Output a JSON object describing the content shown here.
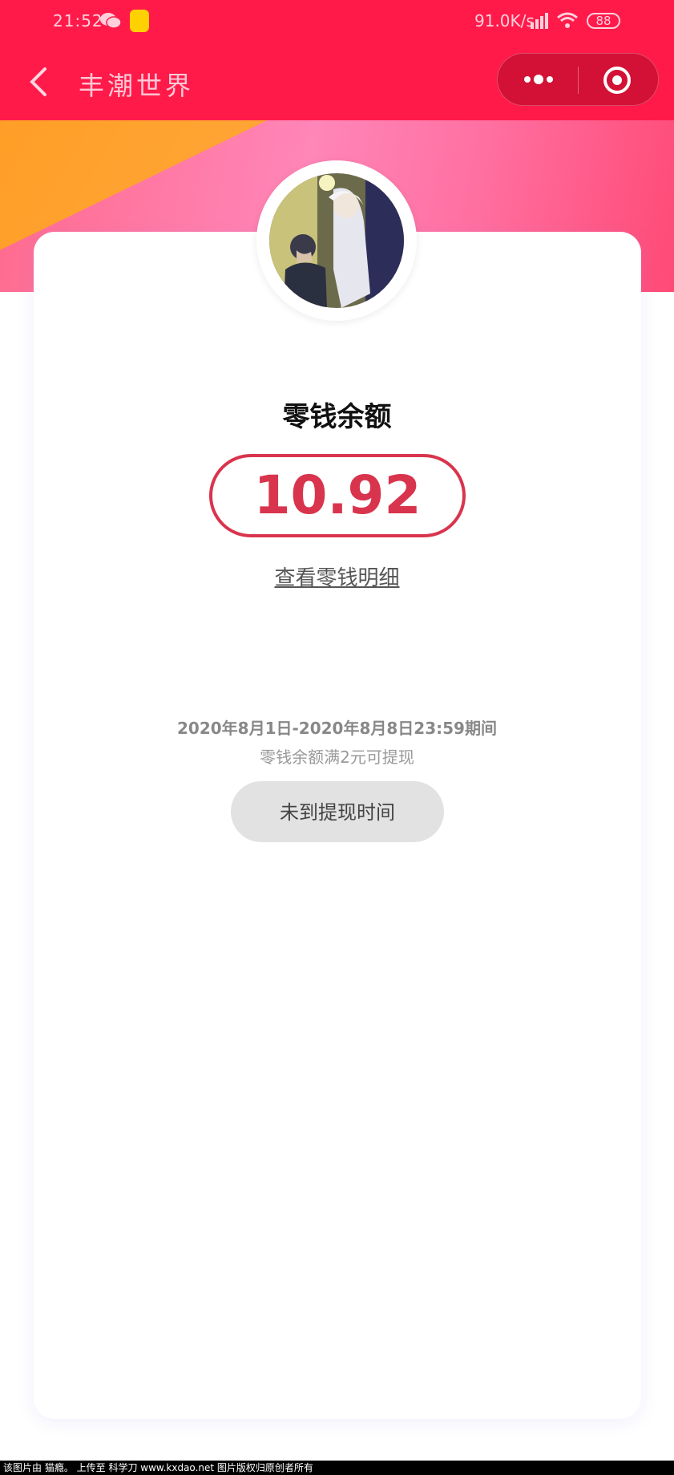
{
  "status_bar": {
    "time": "21:52",
    "network_speed": "91.0K/s",
    "battery": "88",
    "icons": [
      "wechat-icon",
      "app-notification-icon",
      "signal-icon",
      "wifi-icon",
      "battery-icon"
    ]
  },
  "nav": {
    "title": "丰潮世界",
    "icons": [
      "back-icon",
      "more-icon",
      "close-miniprogram-icon"
    ]
  },
  "wallet": {
    "title": "零钱余额",
    "amount": "10.92",
    "detail_link": "查看零钱明细",
    "period": "2020年8月1日-2020年8月8日23:59期间",
    "condition": "零钱余额满2元可提现",
    "withdraw_button": "未到提现时间"
  },
  "footer": {
    "watermark": "该图片由 猫瘾。 上传至 科学刀 www.kxdao.net 图片版权归原创者所有"
  },
  "colors": {
    "header": "#ff1a4a",
    "accent": "#d9344d",
    "hero_pink": "#ff86b8",
    "hero_orange": "#ff9a1f",
    "button_bg": "#e2e2e2"
  }
}
